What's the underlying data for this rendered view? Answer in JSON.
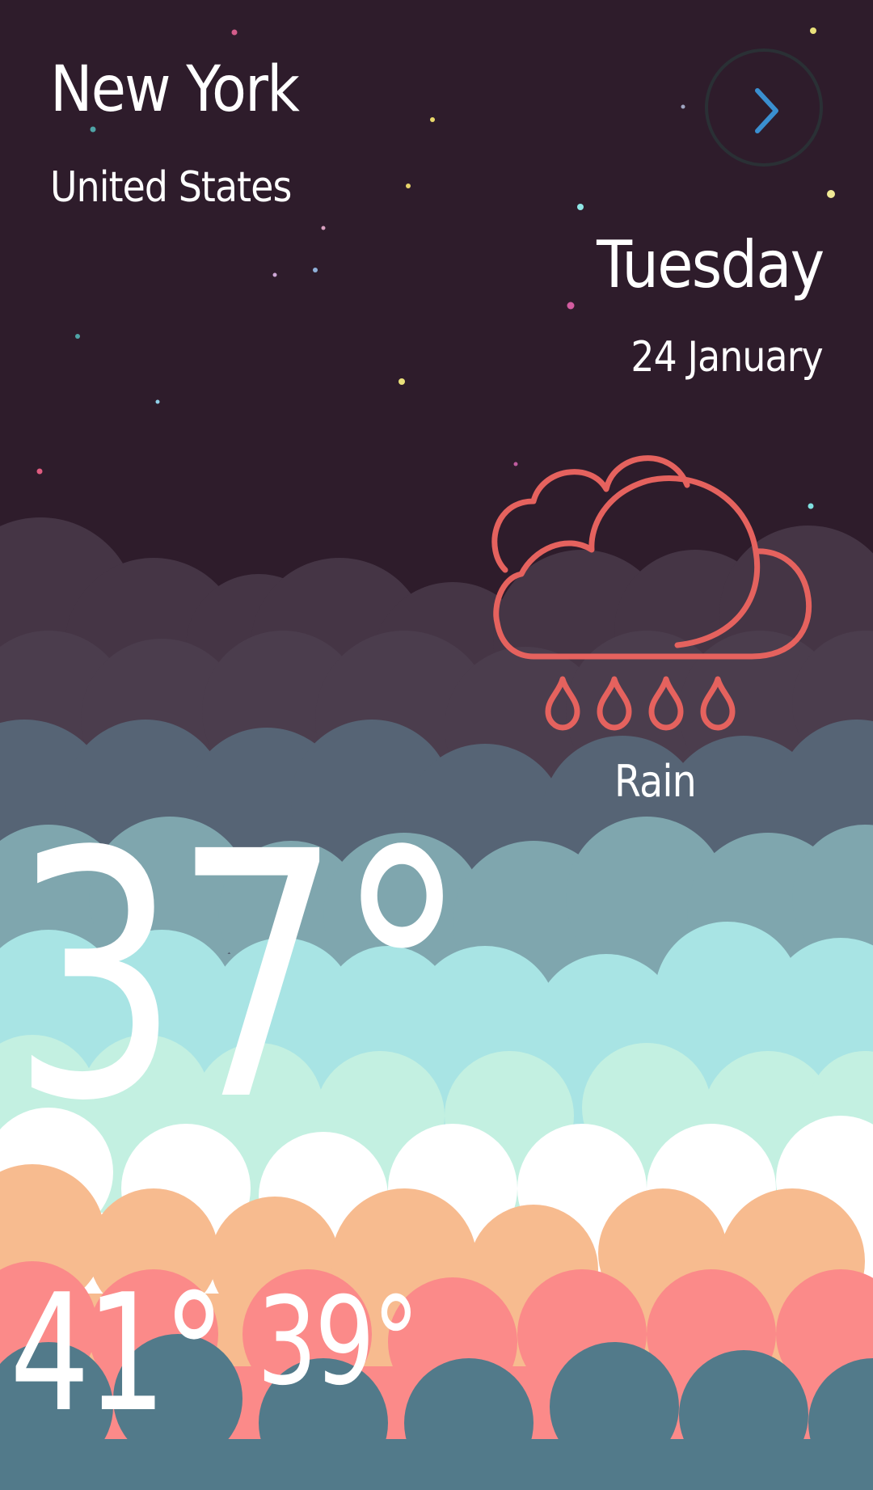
{
  "location": {
    "city": "New York",
    "country": "United States"
  },
  "date": {
    "day": "Tuesday",
    "date": "24 January"
  },
  "weather": {
    "condition": "Rain",
    "icon": "cloud-rain-icon",
    "current_temp": "37°",
    "high_temp": "41°",
    "low_temp": "39°"
  },
  "navigation": {
    "next_icon": "chevron-right-icon"
  },
  "colors": {
    "background": "#2e1c2b",
    "accent_icon": "#e5625e",
    "next_chevron": "#3a8fd0",
    "text": "#ffffff",
    "cloud_layers": [
      "#453545",
      "#4b3d4d",
      "#566475",
      "#7fa6ae",
      "#a8e4e4",
      "#c3f0e1",
      "#ffffff",
      "#f7bb8f",
      "#fb8a89",
      "#527a8a"
    ]
  }
}
